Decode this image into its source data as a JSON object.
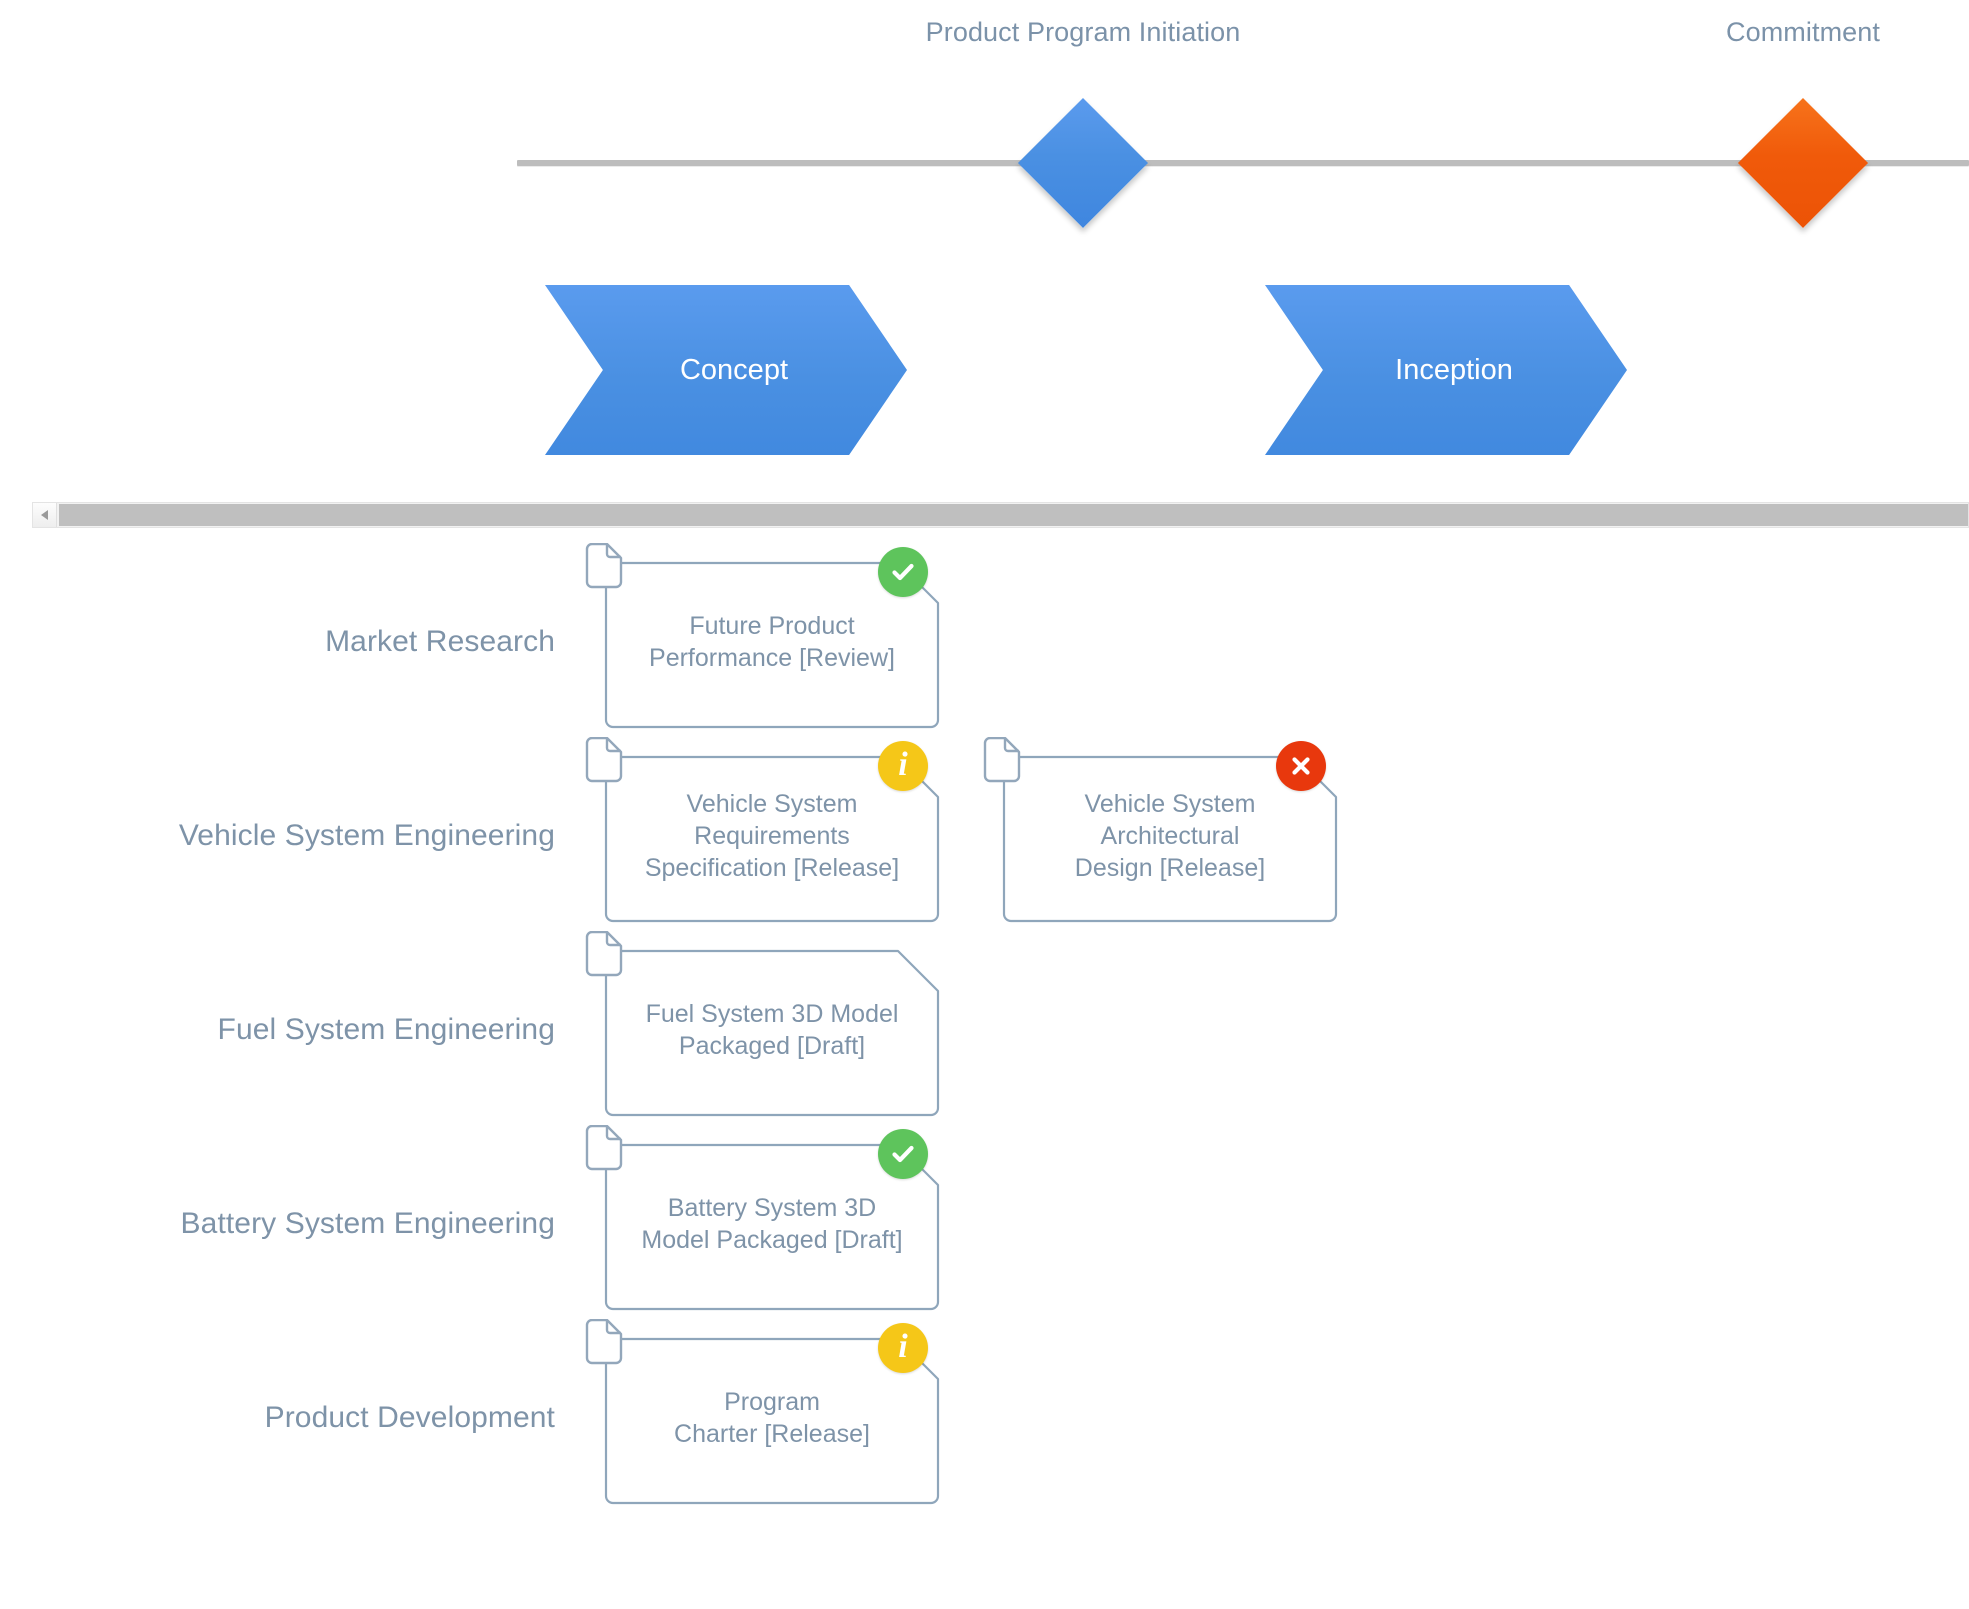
{
  "timeline": {
    "milestones": [
      {
        "id": "product-program-initiation",
        "label": "Product Program Initiation",
        "shape": "diamond",
        "color": "#4a90e2"
      },
      {
        "id": "commitment",
        "label": "Commitment",
        "shape": "diamond",
        "color": "#ef5306"
      }
    ],
    "phases": [
      {
        "id": "concept",
        "label": "Concept",
        "color": "#4a90e2"
      },
      {
        "id": "inception",
        "label": "Inception",
        "color": "#4a90e2"
      }
    ]
  },
  "scrollbar": {
    "left_arrow_icon": "triangle-left-icon",
    "orientation": "horizontal"
  },
  "lanes": [
    {
      "id": "market-research",
      "label": "Market Research",
      "cards": [
        {
          "id": "future-product-performance",
          "lines": [
            "Future Product",
            "Performance [Review]"
          ],
          "doc_icon": "document-icon",
          "badge": {
            "type": "ok",
            "icon": "check-circle-icon",
            "color": "#5ec45c"
          }
        }
      ]
    },
    {
      "id": "vehicle-system-engineering",
      "label": "Vehicle System Engineering",
      "cards": [
        {
          "id": "vehicle-system-requirements-specification",
          "lines": [
            "Vehicle System",
            "Requirements",
            "Specification [Release]"
          ],
          "doc_icon": "document-icon",
          "badge": {
            "type": "info",
            "icon": "info-circle-icon",
            "color": "#f5c718",
            "glyph": "i"
          }
        },
        {
          "id": "vehicle-system-architectural-design",
          "lines": [
            "Vehicle System",
            "Architectural",
            "Design [Release]"
          ],
          "doc_icon": "document-icon",
          "badge": {
            "type": "err",
            "icon": "error-circle-icon",
            "color": "#e8380d"
          }
        }
      ]
    },
    {
      "id": "fuel-system-engineering",
      "label": "Fuel System Engineering",
      "cards": [
        {
          "id": "fuel-system-3d-model-packaged",
          "lines": [
            "Fuel System 3D Model",
            "Packaged [Draft]"
          ],
          "doc_icon": "document-icon",
          "badge": null
        }
      ]
    },
    {
      "id": "battery-system-engineering",
      "label": "Battery System Engineering",
      "cards": [
        {
          "id": "battery-system-3d-model-packaged",
          "lines": [
            "Battery System 3D",
            "Model Packaged [Draft]"
          ],
          "doc_icon": "document-icon",
          "badge": {
            "type": "ok",
            "icon": "check-circle-icon",
            "color": "#5ec45c"
          }
        }
      ]
    },
    {
      "id": "product-development",
      "label": "Product Development",
      "cards": [
        {
          "id": "program-charter",
          "lines": [
            "Program",
            "Charter [Release]"
          ],
          "doc_icon": "document-icon",
          "badge": {
            "type": "info",
            "icon": "info-circle-icon",
            "color": "#f5c718",
            "glyph": "i"
          }
        }
      ]
    }
  ]
}
